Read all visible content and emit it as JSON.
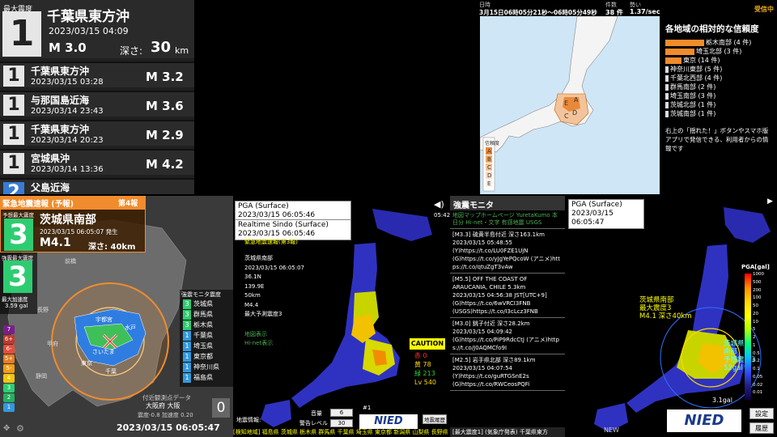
{
  "latest_quake": {
    "label": "最大震度",
    "intensity": "1",
    "region": "千葉県東方沖",
    "time": "2023/03/15 04:09",
    "magnitude": "M 3.0",
    "depth_label": "深さ:",
    "depth": "30",
    "depth_unit": "km"
  },
  "quake_list": [
    {
      "intensity": "1",
      "region": "千葉県東方沖",
      "time": "2023/03/15 03:28",
      "magnitude": "M 3.2"
    },
    {
      "intensity": "1",
      "region": "与那国島近海",
      "time": "2023/03/14 23:43",
      "magnitude": "M 3.6"
    },
    {
      "intensity": "1",
      "region": "千葉県東方沖",
      "time": "2023/03/14 20:23",
      "magnitude": "M 2.9"
    },
    {
      "intensity": "1",
      "region": "宮城県沖",
      "time": "2023/03/14 13:36",
      "magnitude": "M 4.2"
    },
    {
      "intensity": "2",
      "region": "父島近海",
      "time": "",
      "magnitude": ""
    }
  ],
  "reports": {
    "col1_title": "日時",
    "col1_value": "3月15日06時05分21秒～06時05分49秒",
    "col2_title": "件数",
    "col2_value": "38 件",
    "col3_title": "勢い",
    "col3_value": "1.37/sec",
    "status": "受信中",
    "reliability_title": "各地域の相対的な信頼度",
    "regions": [
      {
        "name": "栃木南部 (4 件)",
        "level": 0.6
      },
      {
        "name": "埼玉北部 (3 件)",
        "level": 0.45
      },
      {
        "name": "東京 (14 件)",
        "level": 0.25
      },
      {
        "name": "神奈川東部 (5 件)",
        "level": 0.05
      },
      {
        "name": "千葉北西部 (4 件)",
        "level": 0.05
      },
      {
        "name": "群馬南部 (2 件)",
        "level": 0.05
      },
      {
        "name": "埼玉南部 (3 件)",
        "level": 0.05
      },
      {
        "name": "茨城北部 (1 件)",
        "level": 0.05
      },
      {
        "name": "茨城南部 (1 件)",
        "level": 0.05
      }
    ],
    "note": "右上の「揺れた！」ボタンやスマホ版アプリで発信できる、利用者からの情報です",
    "legend_title": "信頼度",
    "legend_levels": [
      "A",
      "B",
      "C",
      "D",
      "E"
    ]
  },
  "eew": {
    "title": "緊急地震速報 (予報)",
    "report_no": "第4報",
    "max_label": "予想最大震度",
    "max_int": "3",
    "region": "茨城県南部",
    "time": "2023/03/15 06:05:07 発生",
    "magnitude": "M4.1",
    "depth": "深さ: 40km",
    "obs_label": "強震最大震度",
    "obs_int": "3",
    "pga_label": "最大加速度",
    "pga_value": "3.59 gal",
    "monitor_title": "強震モニタ震度",
    "monitor": [
      {
        "int": "3",
        "name": "茨城県"
      },
      {
        "int": "3",
        "name": "群馬県"
      },
      {
        "int": "3",
        "name": "栃木県"
      },
      {
        "int": "1",
        "name": "千葉県"
      },
      {
        "int": "1",
        "name": "埼玉県"
      },
      {
        "int": "1",
        "name": "東京都"
      },
      {
        "int": "1",
        "name": "神奈川県"
      },
      {
        "int": "1",
        "name": "福島県"
      }
    ],
    "near_label": "付近観測点データ",
    "near_place": "大阪府 大阪",
    "near_vals": "震度-0.8 加速度 0.20",
    "near_int": "0",
    "timestamp": "2023/03/15 06:05:47",
    "intensity_scale": [
      "7",
      "6+",
      "6-",
      "5+",
      "5-",
      "4",
      "3",
      "2",
      "1"
    ],
    "intensity_colors": [
      "#7a1f8a",
      "#c0392b",
      "#e74c3c",
      "#e67e22",
      "#f39c12",
      "#f1c40f",
      "#2ecc71",
      "#27ae60",
      "#3498db"
    ],
    "map_places": [
      "宇都宮",
      "水戸",
      "東京",
      "千葉",
      "長野",
      "甲府",
      "静岡",
      "さいたま",
      "前橋"
    ]
  },
  "pga1": {
    "box1_a": "PGA (Surface)",
    "box1_b": "2023/03/15 06:05:46",
    "box2_a": "Realtime Sindo (Surface)",
    "box2_b": "2023/03/15 06:05:46",
    "clock": "05:42",
    "eew_title": "緊急地震速報(第3報)",
    "eew_region": "茨城県南部",
    "eew_time": "2023/03/15 06:05:07",
    "eew_lat": "36.1N",
    "eew_lon": "139.9E",
    "eew_depth": "50km",
    "eew_mag": "M4.4",
    "eew_max": "最大予測震度3",
    "eew_note1": "地図表示",
    "eew_note2": "Hi-net表示",
    "caution": "CAUTION",
    "counts": [
      {
        "label": "赤 0",
        "color": "#ff3333"
      },
      {
        "label": "黄 78",
        "color": "#ffd700"
      },
      {
        "label": "緑 213",
        "color": "#33cc33"
      },
      {
        "label": "Lv 540",
        "color": "#ffd700"
      }
    ],
    "volume_label": "音量",
    "volume_value": "6",
    "alert_label": "警告レベル",
    "alert_value": "30",
    "index": "#1",
    "bottom_label": "地震情報:",
    "bottom_text": "[検知地域] 福島県 茨城県 栃木県 群馬県 千葉県 埼玉県 東京都 新潟県 山梨県 長野県",
    "logo": "NIED",
    "btn": "地震履歴"
  },
  "feed": {
    "title": "強震モニタ",
    "links": "地図マップホームページ YuretaKumo 本日分 Hi-net・文字 有感地震 USGS",
    "items": [
      {
        "head": "[M3.3] 硫黄半島付近 深さ163.1km",
        "time": "2023/03/15 05:48:55",
        "lines": [
          "(Y)https://t.co/LU0FZE1UjN",
          "(G)https://t.co/yJgYePQcoW (アニメ)https://t.co/qtuZgT3vAw"
        ]
      },
      {
        "head": "[M5.5] OFF THE COAST OF ARAUCANIA, CHILE 5.3km",
        "time": "2023/03/15 04:56:38 JST[UTC+9]",
        "lines": [
          "(G)https://t.co/6wVRCI3FNB",
          "(USGS)https://t.co/I3cLcz3FNB"
        ]
      },
      {
        "head": "[M3.0] 銚子付近 深さ28.2km",
        "time": "2023/03/15 04:09:42",
        "lines": [
          "(G)https://t.co/PiP9RdcCtJ (アニメ)https://t.co/J0AQMCfo9I"
        ]
      },
      {
        "head": "[M2.5] 岩手県北部 深さ89.1km",
        "time": "2023/03/15 04:07:54",
        "lines": [
          "(Y)https://t.co/guRTGSnE2s",
          "(G)https://t.co/RWCeosPQFi"
        ]
      }
    ],
    "footer": "[最大震度1] (気象庁発表) 千葉県東方"
  },
  "pga2": {
    "box_a": "PGA (Surface)",
    "box_b": "2023/03/15 06:05:47",
    "scale_title": "PGA[gal]",
    "scale_ticks": [
      "1000",
      "500",
      "200",
      "100",
      "50",
      "20",
      "10",
      "5",
      "2",
      "1",
      "0.5",
      "0.2",
      "0.1",
      "0.05",
      "0.02",
      "0.01"
    ],
    "epi1": "茨城県南部",
    "epi2": "最大震度3",
    "epi3": "M4.1 深さ40km",
    "side1": "茨城県",
    "side2": "南部",
    "side3": "予想震度3",
    "side4": "52gal",
    "gal": "3.1gal",
    "new": "NEW",
    "logo": "NIED",
    "btn1": "設定",
    "btn2": "履歴"
  }
}
